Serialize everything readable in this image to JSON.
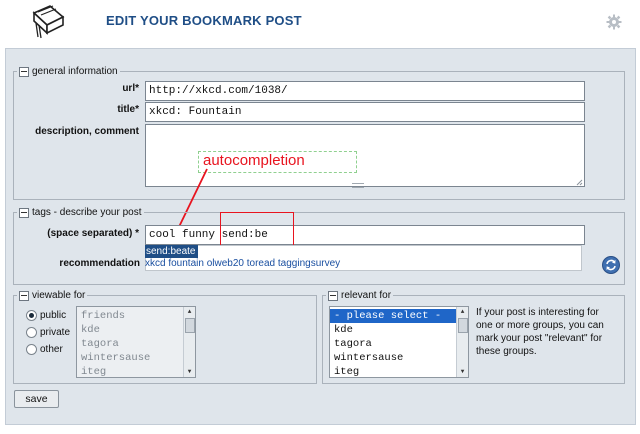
{
  "header": {
    "title": "EDIT YOUR BOOKMARK POST",
    "book_icon": "book-icon",
    "settings_icon": "gear-icon"
  },
  "general": {
    "legend": "general information",
    "url_label": "url*",
    "url_value": "http://xkcd.com/1038/",
    "title_label": "title*",
    "title_value": "xkcd: Fountain",
    "description_label": "description, comment",
    "description_value": ""
  },
  "tags": {
    "legend": "tags - describe your post",
    "field_label": "(space separated) *",
    "value_prefix": "cool funny",
    "value_typed": "send:be",
    "suggestion": "send:beate",
    "recommendation_label": "recommendation",
    "recommendations": [
      "xkcd",
      "fountain",
      "olweb20",
      "toread",
      "taggingsurvey"
    ]
  },
  "annotation": {
    "text": "autocompletion"
  },
  "viewable": {
    "legend": "viewable for",
    "options": [
      "public",
      "private",
      "other"
    ],
    "selected": "public",
    "groups": [
      "friends",
      "kde",
      "tagora",
      "wintersause",
      "iteg"
    ]
  },
  "relevant": {
    "legend": "relevant for",
    "options": [
      "- please select -",
      "kde",
      "tagora",
      "wintersause",
      "iteg"
    ],
    "selected": "- please select -",
    "help": "If your post is interesting for one or more groups, you can mark your post \"relevant\" for these groups."
  },
  "actions": {
    "save_label": "save"
  },
  "colors": {
    "title": "#1f4e86",
    "panel": "#dfe5eb",
    "annotation": "#e8141f",
    "selection": "#1f66c8"
  }
}
